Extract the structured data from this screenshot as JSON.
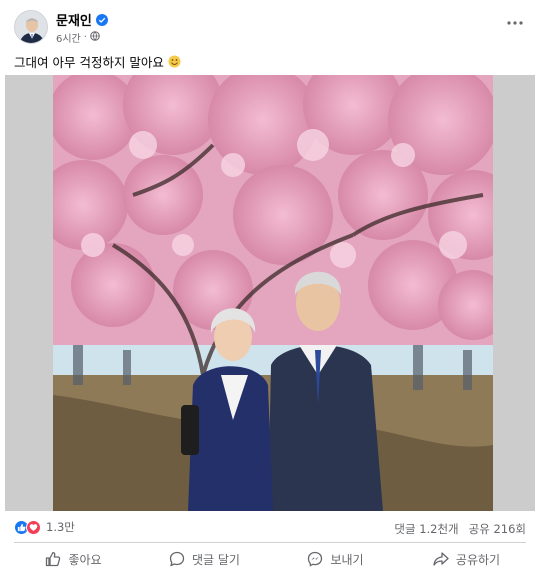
{
  "post": {
    "author": "문재인",
    "time": "6시간",
    "separator": "·",
    "text": "그대여 아무 걱정하지 말아요"
  },
  "icons": {
    "verified": "verified-badge-icon",
    "privacy": "globe-icon",
    "more": "more-options-icon",
    "emoji": "smiling-face-emoji"
  },
  "stats": {
    "reaction_count": "1.3만",
    "comments": "댓글 1.2천개",
    "shares": "공유 216회"
  },
  "actions": {
    "like": "좋아요",
    "comment": "댓글 달기",
    "send": "보내기",
    "share": "공유하기"
  },
  "colors": {
    "accent": "#1877f2",
    "love": "#f33e58",
    "secondary_text": "#65676b"
  }
}
